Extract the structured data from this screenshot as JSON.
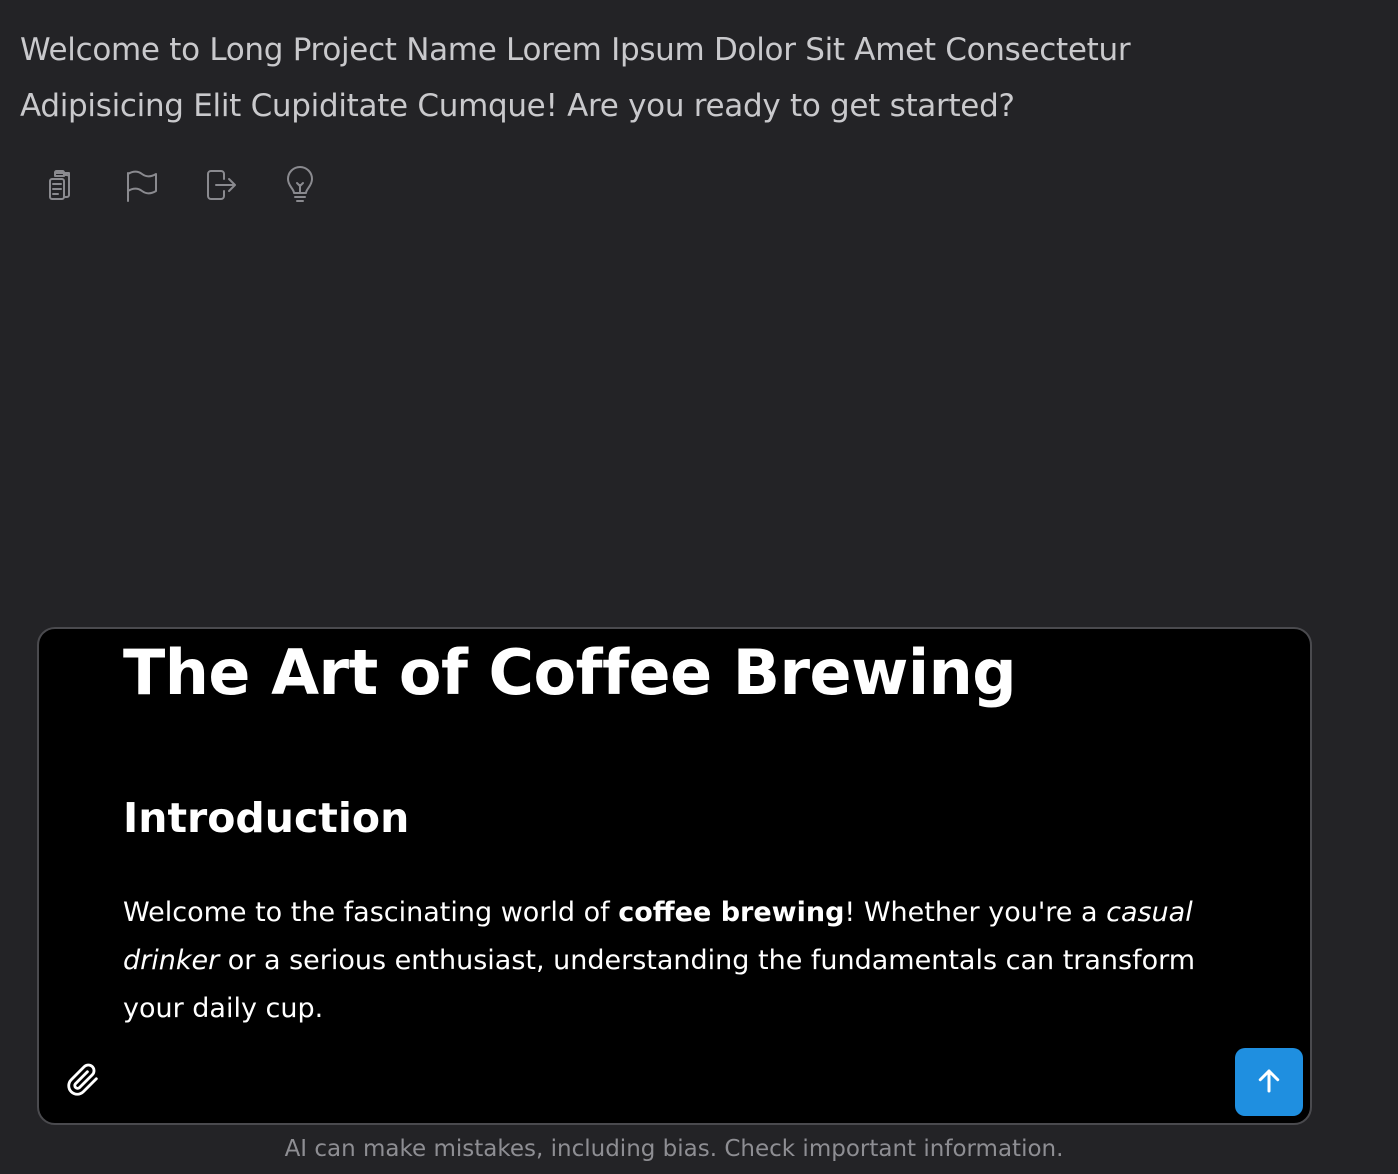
{
  "welcome": {
    "message": "Welcome to Long Project Name Lorem Ipsum Dolor Sit Amet Consectetur Adipisicing Elit Cupiditate Cumque! Are you ready to get started?"
  },
  "message_actions": [
    {
      "icon": "clipboard-icon"
    },
    {
      "icon": "flag-icon"
    },
    {
      "icon": "export-icon"
    },
    {
      "icon": "lightbulb-icon"
    }
  ],
  "composer": {
    "title": "The Art of Coffee Brewing",
    "heading": "Introduction",
    "paragraph": {
      "part1": "Welcome to the fascinating world of ",
      "bold": "coffee brewing",
      "part2": "! Whether you're a ",
      "italic": "casual drinker",
      "part3": " or a serious enthusiast, understanding the fundamentals can transform your daily cup."
    },
    "attach_icon": "paperclip-icon",
    "send_icon": "arrow-up-icon",
    "send_color": "#1f8fe0"
  },
  "disclaimer": "AI can make mistakes, including bias. Check important information."
}
